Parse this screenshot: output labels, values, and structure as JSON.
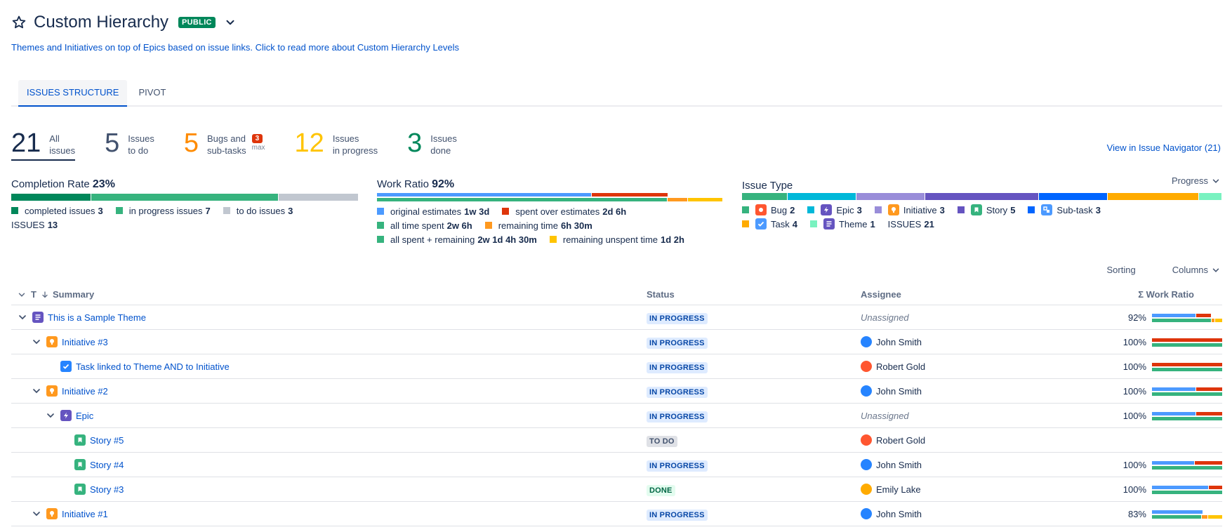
{
  "header": {
    "title": "Custom Hierarchy",
    "badge": "PUBLIC",
    "subtitle": "Themes and Initiatives on top of Epics based on issue links. Click to read more about Custom Hierarchy Levels"
  },
  "tabs": [
    {
      "label": "ISSUES STRUCTURE"
    },
    {
      "label": "PIVOT"
    }
  ],
  "counts": {
    "all": {
      "num": "21",
      "l1": "All",
      "l2": "issues"
    },
    "todo": {
      "num": "5",
      "l1": "Issues",
      "l2": "to do"
    },
    "bugs": {
      "num": "5",
      "l1": "Bugs and",
      "l2": "sub-tasks",
      "badge": "3",
      "max": "max"
    },
    "inprogress": {
      "num": "12",
      "l1": "Issues",
      "l2": "in progress"
    },
    "done": {
      "num": "3",
      "l1": "Issues",
      "l2": "done"
    }
  },
  "navigator_link": "View in Issue Navigator (21)",
  "completion": {
    "label": "Completion Rate",
    "value": "23%",
    "segments": [
      {
        "fraction": 0.2308,
        "color": "#00875a"
      },
      {
        "fraction": 0.5385,
        "color": "#36b37e"
      },
      {
        "fraction": 0.2308,
        "color": "#c1c7d0"
      }
    ],
    "legend": [
      {
        "label": "completed issues",
        "value": "3",
        "color": "#00875a"
      },
      {
        "label": "in progress issues",
        "value": "7",
        "color": "#36b37e"
      },
      {
        "label": "to do issues",
        "value": "3",
        "color": "#c1c7d0"
      }
    ],
    "total_label": "ISSUES",
    "total_value": "13"
  },
  "work_ratio": {
    "label": "Work Ratio",
    "value": "92%",
    "legend": [
      {
        "label": "original estimates",
        "value": "1w 3d",
        "color": "#4c9aff"
      },
      {
        "label": "spent over estimates",
        "value": "2d 6h",
        "color": "#de350b"
      },
      {
        "label": "all time spent",
        "value": "2w 6h",
        "color": "#36b37e"
      },
      {
        "label": "remaining time",
        "value": "6h 30m",
        "color": "#ff991f"
      },
      {
        "label": "all spent + remaining",
        "value": "2w 1d 4h 30m",
        "color": "#36b37e"
      },
      {
        "label": "remaining unspent time",
        "value": "1d 2h",
        "color": "#ffc400"
      }
    ]
  },
  "issue_type": {
    "label": "Issue Type",
    "dropdown": "Progress",
    "legend": [
      {
        "label": "Bug",
        "value": "2",
        "color": "#36b37e",
        "icon": "bug-icon",
        "icon_color": "#ff5630"
      },
      {
        "label": "Epic",
        "value": "3",
        "color": "#00b8d9",
        "icon": "epic-icon",
        "icon_color": "#6554c0"
      },
      {
        "label": "Initiative",
        "value": "3",
        "color": "#998dd9",
        "icon": "initiative-icon",
        "icon_color": "#ff991f"
      },
      {
        "label": "Story",
        "value": "5",
        "color": "#6554c0",
        "icon": "story-icon",
        "icon_color": "#36b37e"
      },
      {
        "label": "Sub-task",
        "value": "3",
        "color": "#0065ff",
        "icon": "subtask-icon",
        "icon_color": "#4c9aff"
      },
      {
        "label": "Task",
        "value": "4",
        "color": "#ffab00",
        "icon": "task-icon",
        "icon_color": "#4c9aff"
      },
      {
        "label": "Theme",
        "value": "1",
        "color": "#79f2c0",
        "icon": "theme-icon",
        "icon_color": "#6554c0"
      }
    ],
    "total_label": "ISSUES",
    "total_value": "21"
  },
  "table_controls": {
    "sorting": "Sorting",
    "columns": "Columns"
  },
  "columns": {
    "summary": "Summary",
    "status": "Status",
    "assignee": "Assignee",
    "work_ratio": "Σ Work Ratio"
  },
  "rows": [
    {
      "summary": "This is a Sample Theme",
      "status": "IN PROGRESS",
      "assignee": "Unassigned",
      "ratio": "92%"
    },
    {
      "summary": "Initiative #3",
      "status": "IN PROGRESS",
      "assignee": "John Smith",
      "ratio": "100%"
    },
    {
      "summary": "Task linked to Theme AND to Initiative",
      "status": "IN PROGRESS",
      "assignee": "Robert Gold",
      "ratio": "100%"
    },
    {
      "summary": "Initiative #2",
      "status": "IN PROGRESS",
      "assignee": "John Smith",
      "ratio": "100%"
    },
    {
      "summary": "Epic",
      "status": "IN PROGRESS",
      "assignee": "Unassigned",
      "ratio": "100%"
    },
    {
      "summary": "Story #5",
      "status": "TO DO",
      "assignee": "Robert Gold",
      "ratio": ""
    },
    {
      "summary": "Story #4",
      "status": "IN PROGRESS",
      "assignee": "John Smith",
      "ratio": "100%"
    },
    {
      "summary": "Story #3",
      "status": "DONE",
      "assignee": "Emily Lake",
      "ratio": "100%"
    },
    {
      "summary": "Initiative #1",
      "status": "IN PROGRESS",
      "assignee": "John Smith",
      "ratio": "83%"
    }
  ]
}
